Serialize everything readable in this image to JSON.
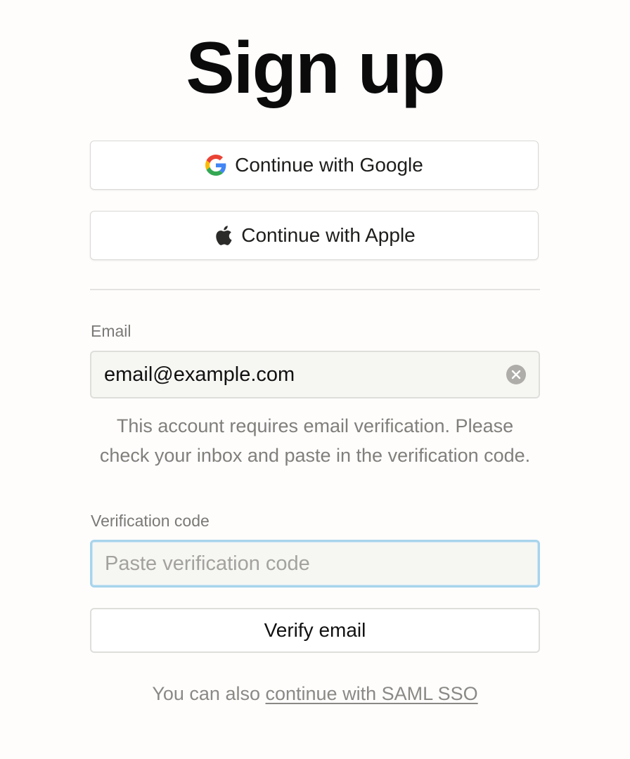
{
  "page": {
    "title": "Sign up"
  },
  "oauth": {
    "google_label": "Continue with Google",
    "apple_label": "Continue with Apple",
    "google_icon": "google-g-icon",
    "apple_icon": "apple-icon"
  },
  "email": {
    "label": "Email",
    "value": "email@example.com",
    "clear_icon": "clear-circle-icon"
  },
  "hint": {
    "text": "This account requires email verification. Please check your inbox and paste in the verification code."
  },
  "code": {
    "label": "Verification code",
    "placeholder": "Paste verification code",
    "value": ""
  },
  "verify": {
    "label": "Verify email"
  },
  "footer": {
    "prefix": "You can also ",
    "link": "continue with SAML SSO"
  },
  "colors": {
    "background": "#fefdfc",
    "focus_ring": "#a8d4ec",
    "muted_text": "#807f7b"
  }
}
